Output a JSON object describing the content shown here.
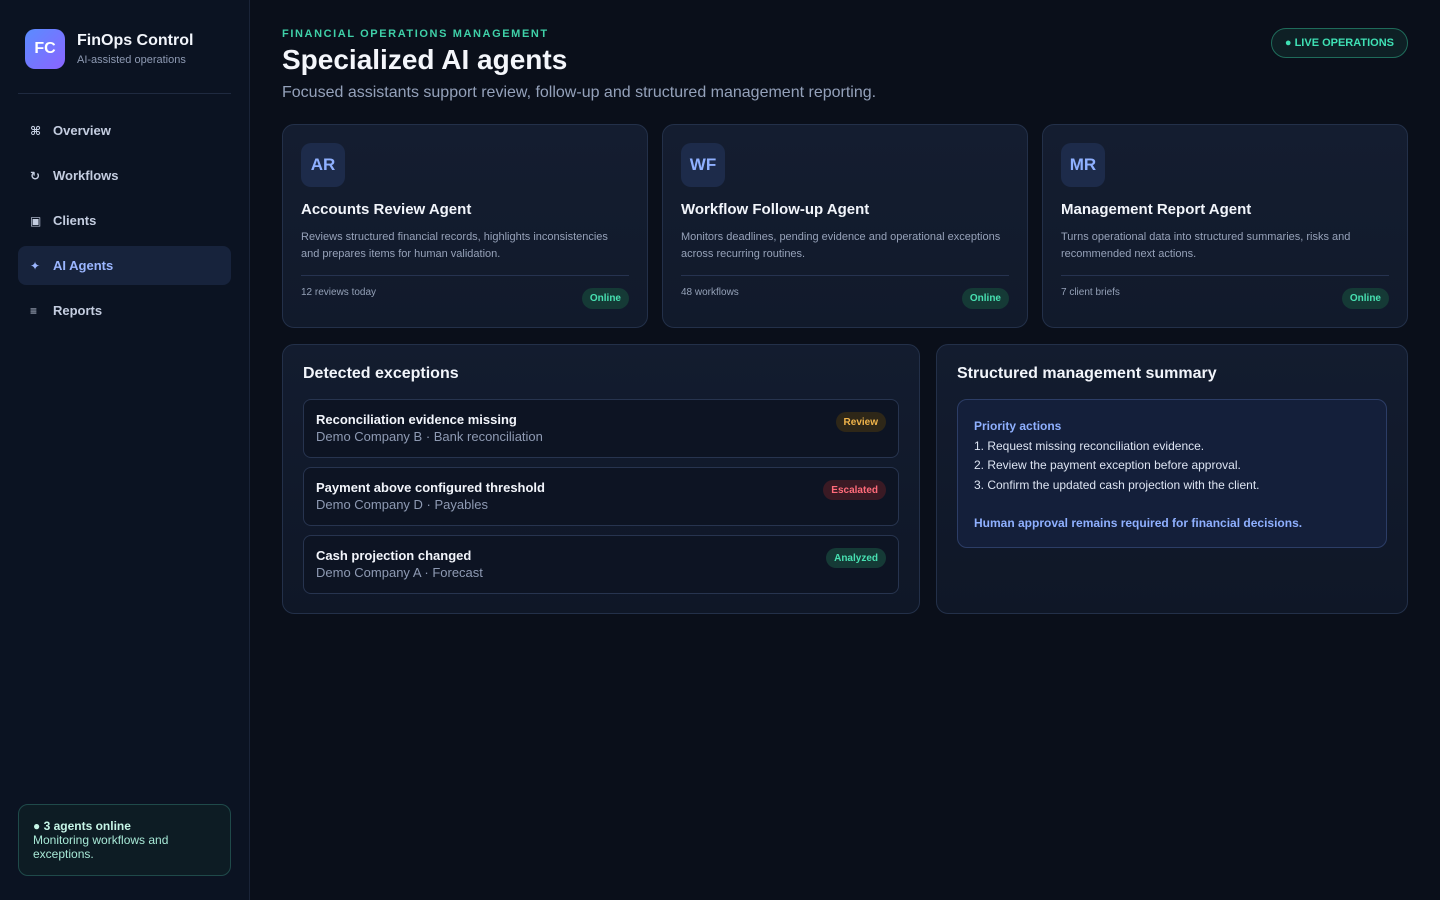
{
  "brand": {
    "logo": "FC",
    "name": "FinOps Control",
    "subtitle": "AI-assisted operations"
  },
  "nav": {
    "items": [
      {
        "icon": "⌘",
        "icon_name": "command-icon",
        "label": "Overview"
      },
      {
        "icon": "↻",
        "icon_name": "refresh-icon",
        "label": "Workflows"
      },
      {
        "icon": "▣",
        "icon_name": "clients-icon",
        "label": "Clients"
      },
      {
        "icon": "✦",
        "icon_name": "sparkle-icon",
        "label": "AI Agents",
        "active": true
      },
      {
        "icon": "≡",
        "icon_name": "reports-icon",
        "label": "Reports"
      }
    ]
  },
  "sidebar_status": {
    "title": "● 3 agents online",
    "description": "Monitoring workflows and exceptions."
  },
  "header": {
    "eyebrow": "FINANCIAL OPERATIONS MANAGEMENT",
    "title": "Specialized AI agents",
    "subtitle": "Focused assistants support review, follow-up and structured management reporting.",
    "live_badge": "● LIVE OPERATIONS"
  },
  "agents": [
    {
      "initials": "AR",
      "name": "Accounts Review Agent",
      "description": "Reviews structured financial records, highlights inconsistencies and prepares items for human validation.",
      "metric": "12 reviews today",
      "status": "Online"
    },
    {
      "initials": "WF",
      "name": "Workflow Follow-up Agent",
      "description": "Monitors deadlines, pending evidence and operational exceptions across recurring routines.",
      "metric": "48 workflows",
      "status": "Online"
    },
    {
      "initials": "MR",
      "name": "Management Report Agent",
      "description": "Turns operational data into structured summaries, risks and recommended next actions.",
      "metric": "7 client briefs",
      "status": "Online"
    }
  ],
  "exceptions": {
    "title": "Detected exceptions",
    "items": [
      {
        "title": "Reconciliation evidence missing",
        "subtitle": "Demo Company B · Bank reconciliation",
        "badge": "Review",
        "badge_color": "#f0b44a",
        "badge_bg": "#2e2718"
      },
      {
        "title": "Payment above configured threshold",
        "subtitle": "Demo Company D · Payables",
        "badge": "Escalated",
        "badge_color": "#ff6b7a",
        "badge_bg": "#3a1a24"
      },
      {
        "title": "Cash projection changed",
        "subtitle": "Demo Company A · Forecast",
        "badge": "Analyzed",
        "badge_color": "#47e0b1",
        "badge_bg": "#153a36"
      }
    ]
  },
  "summary": {
    "title": "Structured management summary",
    "heading": "Priority actions",
    "actions": [
      "1. Request missing reconciliation evidence.",
      "2. Review the payment exception before approval.",
      "3. Confirm the updated cash projection with the client."
    ],
    "note": "Human approval remains required for financial decisions."
  },
  "colors": {
    "accent": "#8fb0ff",
    "success": "#47e0b1",
    "warning": "#f0b44a",
    "danger": "#ff6b7a",
    "background": "#0a0f1a"
  }
}
